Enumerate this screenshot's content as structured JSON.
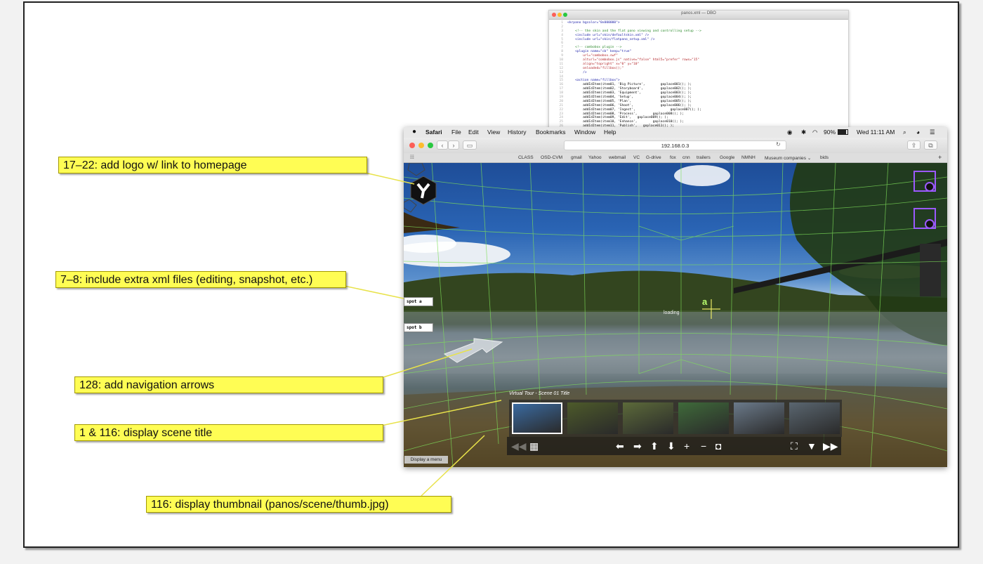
{
  "editor": {
    "title": "panos.xml — DBO",
    "lines": [
      {
        "n": "1",
        "t": "<krpano bgcolor=\"0x000000\">",
        "k": "tag"
      },
      {
        "n": "2",
        "t": "",
        "k": ""
      },
      {
        "n": "3",
        "t": "    <!-- the skin and the flat pano viewing and controlling setup -->",
        "k": "com"
      },
      {
        "n": "4",
        "t": "    <include url=\"skin/defaultskin.xml\" />",
        "k": "tag"
      },
      {
        "n": "5",
        "t": "    <include url=\"skin/flatpano_setup.xml\" />",
        "k": "tag"
      },
      {
        "n": "6",
        "t": "",
        "k": ""
      },
      {
        "n": "7",
        "t": "    <!-- combobox plugin -->",
        "k": "com"
      },
      {
        "n": "8",
        "t": "    <plugin name=\"cb\" keep=\"true\"",
        "k": "tag"
      },
      {
        "n": "9",
        "t": "        url=\"combobox.swf\"",
        "k": "str"
      },
      {
        "n": "10",
        "t": "        alturl=\"combobox.js\" native=\"false\" html5=\"prefer\" rows=\"15\"",
        "k": "str"
      },
      {
        "n": "11",
        "t": "        align=\"topright\" x=\"0\" y=\"10\"",
        "k": "str"
      },
      {
        "n": "12",
        "t": "        onloaded=\"fillbox();\"",
        "k": "str"
      },
      {
        "n": "13",
        "t": "        />",
        "k": "tag"
      },
      {
        "n": "14",
        "t": "",
        "k": ""
      },
      {
        "n": "15",
        "t": "    <action name=\"fillbox\">",
        "k": "tag"
      },
      {
        "n": "16",
        "t": "        addIdItem(item01, 'Big Picture',        goplace001(); );",
        "k": ""
      },
      {
        "n": "17",
        "t": "        addIdItem(item02, 'Storyboard',         goplace002(); );",
        "k": ""
      },
      {
        "n": "18",
        "t": "        addIdItem(item03, 'Equipment',          goplace003(); );",
        "k": ""
      },
      {
        "n": "19",
        "t": "        addIdItem(item04, 'Setup',              goplace004(); );",
        "k": ""
      },
      {
        "n": "20",
        "t": "        addIdItem(item05, 'Plan',               goplace005(); );",
        "k": ""
      },
      {
        "n": "21",
        "t": "        addIdItem(item06, 'Shoot',              goplace006(); );",
        "k": ""
      },
      {
        "n": "22",
        "t": "        addIdItem(item07, 'Ingest',                  goplace007(); );",
        "k": ""
      },
      {
        "n": "23",
        "t": "        addIdItem(item08, 'Process',        goplace008(); );",
        "k": ""
      },
      {
        "n": "24",
        "t": "        addIdItem(item09, 'Edit',   goplace009(); );",
        "k": ""
      },
      {
        "n": "25",
        "t": "        addIdItem(item10, 'Enhance',        goplace010(); );",
        "k": ""
      },
      {
        "n": "26",
        "t": "        addIdItem(item11, 'Publish',   goplace011(); );",
        "k": ""
      }
    ]
  },
  "browser": {
    "apple_icon": "apple-icon",
    "menu": [
      "Safari",
      "File",
      "Edit",
      "View",
      "History",
      "Bookmarks",
      "Window",
      "Help"
    ],
    "status": {
      "battery": "90%",
      "clock": "Wed 11:11 AM"
    },
    "url": "192.168.0.3",
    "favorites": [
      "CLASS",
      "OSD-CVM",
      "gmail",
      "Yahoo",
      "webmail",
      "VC",
      "G-drive",
      "fox",
      "cnn",
      "trailers",
      "Google",
      "NMNH",
      "Museum companies ⌄",
      "bids"
    ]
  },
  "pano": {
    "spot_a": "spot a",
    "spot_b": "spot b",
    "hotspot_letter": "a",
    "loading": "loading",
    "scene_title": "Virtual Tour - Scene 01 Title",
    "menu_chip": "Display a menu",
    "thumb_colors": [
      "#3a6aa0",
      "#4d5a2a",
      "#5c6a3a",
      "#3f6a3a",
      "#6b7a8a",
      "#5a6670"
    ]
  },
  "callouts": {
    "logo": "17–22:  add logo w/ link to homepage",
    "xml": "7–8:  include extra xml files (editing, snapshot, etc.)",
    "arrows": "128:  add navigation arrows",
    "title": "1 & 116:  display scene title",
    "thumb": "116:  display thumbnail (panos/scene/thumb.jpg)"
  },
  "colors": {
    "callout": "#fffd54",
    "grid": "#7fe05a",
    "hotspot": "#9b59ff"
  }
}
